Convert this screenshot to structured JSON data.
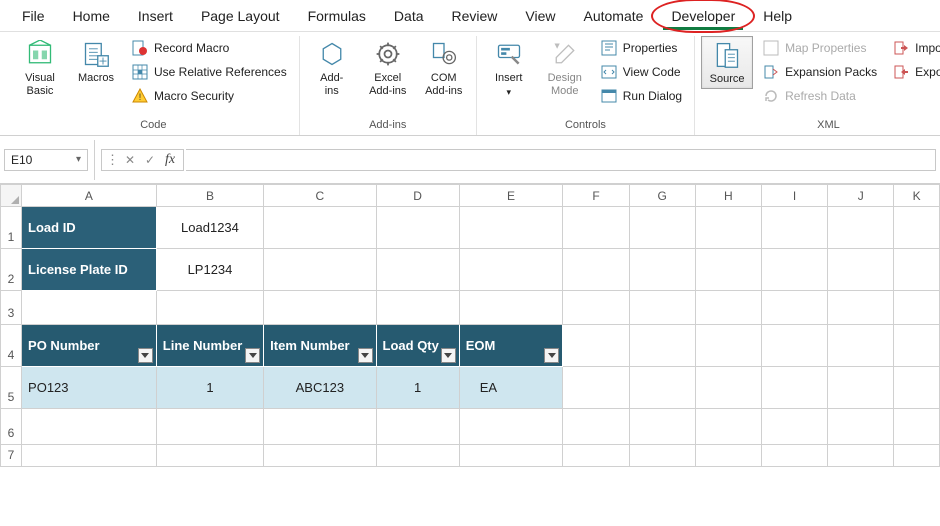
{
  "tabs": {
    "file": "File",
    "home": "Home",
    "insert": "Insert",
    "page_layout": "Page Layout",
    "formulas": "Formulas",
    "data": "Data",
    "review": "Review",
    "view": "View",
    "automate": "Automate",
    "developer": "Developer",
    "help": "Help",
    "active": "developer"
  },
  "ribbon": {
    "code": {
      "label": "Code",
      "visual_basic": "Visual\nBasic",
      "macros": "Macros",
      "record": "Record Macro",
      "relative": "Use Relative References",
      "security": "Macro Security"
    },
    "addins": {
      "label": "Add-ins",
      "addins": "Add-\nins",
      "excel": "Excel\nAdd-ins",
      "com": "COM\nAdd-ins"
    },
    "controls": {
      "label": "Controls",
      "insert": "Insert",
      "design": "Design\nMode",
      "properties": "Properties",
      "view_code": "View Code",
      "run_dialog": "Run Dialog"
    },
    "xml": {
      "label": "XML",
      "source": "Source",
      "map_props": "Map Properties",
      "expansion": "Expansion Packs",
      "refresh": "Refresh Data",
      "import": "Import",
      "export": "Export"
    }
  },
  "formula_bar": {
    "namebox": "E10",
    "formula": ""
  },
  "sheet": {
    "columns": [
      "A",
      "B",
      "C",
      "D",
      "E",
      "F",
      "G",
      "H",
      "I",
      "J",
      "K"
    ],
    "headers": {
      "load_id": "Load ID",
      "license_plate": "License Plate ID"
    },
    "values": {
      "load_id": "Load1234",
      "license_plate": "LP1234"
    },
    "table_headers": {
      "po_number": "PO Number",
      "line_number": "Line Number",
      "item_number": "Item Number",
      "load_qty": "Load Qty",
      "eom": "EOM"
    },
    "table_row": {
      "po": "PO123",
      "line": "1",
      "item": "ABC123",
      "qty": "1",
      "eom": "EA"
    }
  }
}
